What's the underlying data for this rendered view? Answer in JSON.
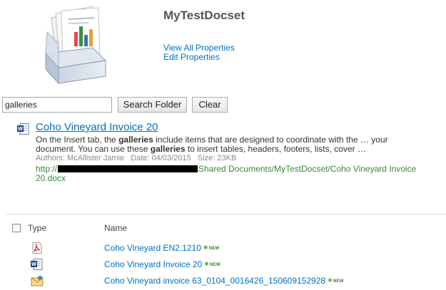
{
  "docset": {
    "title": "MyTestDocset",
    "view_all_properties": "View All Properties",
    "edit_properties": "Edit Properties",
    "icon": "document-set-icon"
  },
  "search": {
    "query": "galleries",
    "search_folder_label": "Search Folder",
    "clear_label": "Clear"
  },
  "result": {
    "title": "Coho Vineyard Invoice 20",
    "snippet_line1_pre": "On the Insert tab, the ",
    "snippet_line1_hit": "galleries",
    "snippet_line1_post": " include items that are designed to coordinate with the … your",
    "snippet_line2_pre": "document. You can use these ",
    "snippet_line2_hit": "galleries",
    "snippet_line2_post": " to insert tables, headers, footers, lists, cover …",
    "authors_label": "Authors:",
    "authors": "McAllister Jamie",
    "date_label": "Date:",
    "date": "04/03/2015",
    "size_label": "Size:",
    "size": "23KB",
    "url_prefix": "http://",
    "url_suffix": "Shared Documents/MyTestDocset/Coho Vineyard Invoice",
    "url_line2": "20.docx",
    "icon": "word-document-icon"
  },
  "list": {
    "col_type": "Type",
    "col_name": "Name",
    "rows": [
      {
        "name": "Coho Vineyard EN2.1210",
        "icon": "pdf-icon",
        "badge": "NEW"
      },
      {
        "name": "Coho Vineyard Invoice 20",
        "icon": "word-document-icon",
        "badge": "NEW"
      },
      {
        "name": "Coho Vineyard invoice 63_0104_0016426_150609152928",
        "icon": "email-message-icon",
        "badge": "NEW"
      }
    ]
  },
  "colors": {
    "link": "#0072bc",
    "url_green": "#388a34",
    "title_gray": "#555555"
  }
}
